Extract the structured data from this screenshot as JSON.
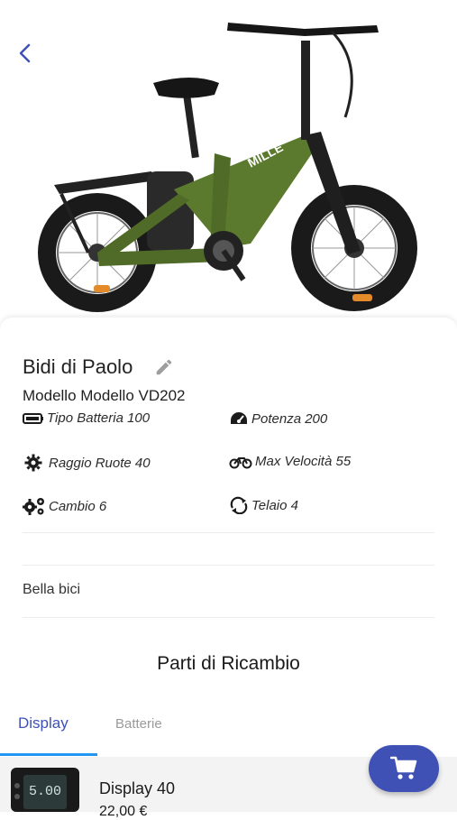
{
  "bike": {
    "name": "Bidi di Paolo",
    "model": "Modello Modello VD202",
    "brand_mark": "MILLE"
  },
  "specs": [
    {
      "label": "Tipo Batteria 100",
      "icon": "battery-icon"
    },
    {
      "label": "Potenza 200",
      "icon": "speedometer-icon"
    },
    {
      "label": "Raggio Ruote 40",
      "icon": "gear-icon"
    },
    {
      "label": "Max Velocità 55",
      "icon": "bicycle-icon"
    },
    {
      "label": "Cambio 6",
      "icon": "cogs-icon"
    },
    {
      "label": "Telaio 4",
      "icon": "sync-icon"
    }
  ],
  "description": "Bella bici",
  "parts": {
    "title": "Parti di Ricambio",
    "tabs": [
      {
        "label": "Display",
        "active": true
      },
      {
        "label": "Batterie",
        "active": false
      }
    ],
    "items": [
      {
        "name": "Display 40",
        "price": "22,00 €",
        "thumb_text": "5.00"
      }
    ]
  },
  "colors": {
    "accent": "#3f51b5",
    "tab_indicator": "#2196f3",
    "frame_green": "#5b7a2e"
  }
}
